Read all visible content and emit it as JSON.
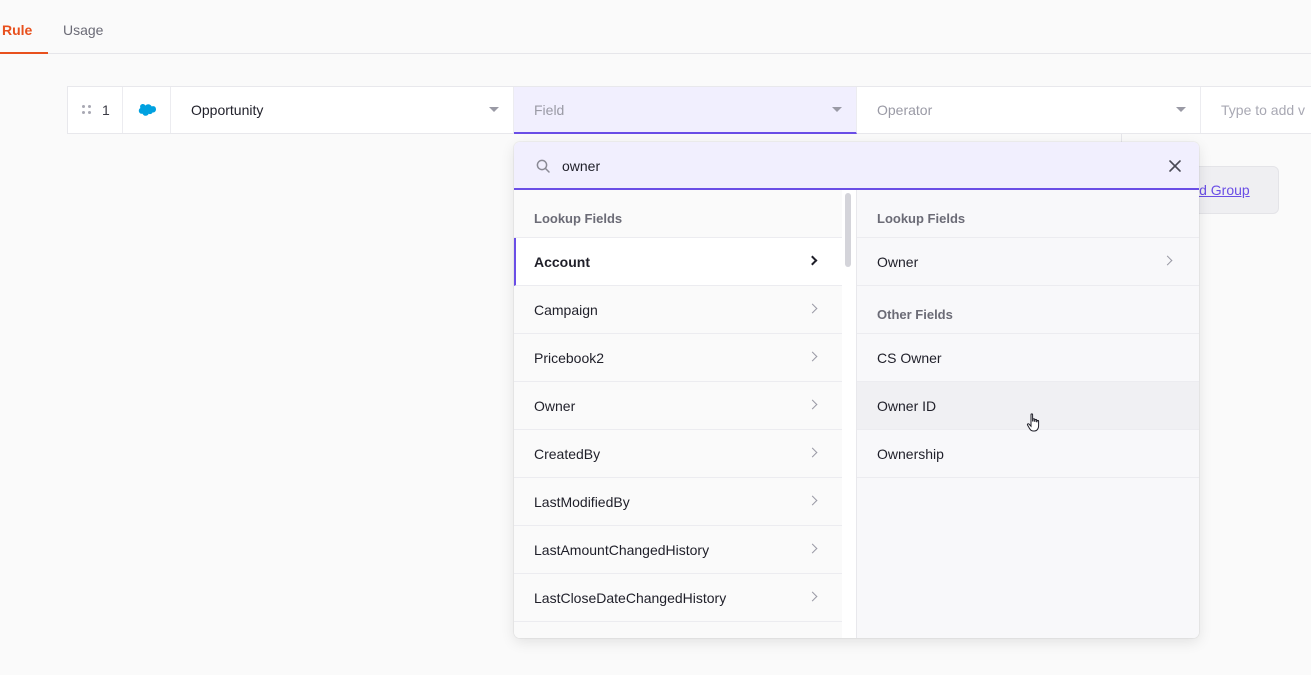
{
  "tabs": {
    "rule": "Rule",
    "usage": "Usage"
  },
  "rule_row": {
    "index": "1",
    "object": "Opportunity",
    "field_placeholder": "Field",
    "operator_placeholder": "Operator",
    "value_placeholder": "Type to add v"
  },
  "add_group_label": "ld Group",
  "dropdown": {
    "search_value": "owner",
    "left": {
      "header": "Lookup Fields",
      "items": [
        "Account",
        "Campaign",
        "Pricebook2",
        "Owner",
        "CreatedBy",
        "LastModifiedBy",
        "LastAmountChangedHistory",
        "LastCloseDateChangedHistory"
      ]
    },
    "right": {
      "lookup_header": "Lookup Fields",
      "lookup_items": [
        "Owner"
      ],
      "other_header": "Other Fields",
      "other_items": [
        "CS Owner",
        "Owner ID",
        "Ownership"
      ]
    }
  },
  "colors": {
    "accent": "#6a4ee6",
    "tab_active": "#e8501d",
    "salesforce": "#00a1e0"
  }
}
